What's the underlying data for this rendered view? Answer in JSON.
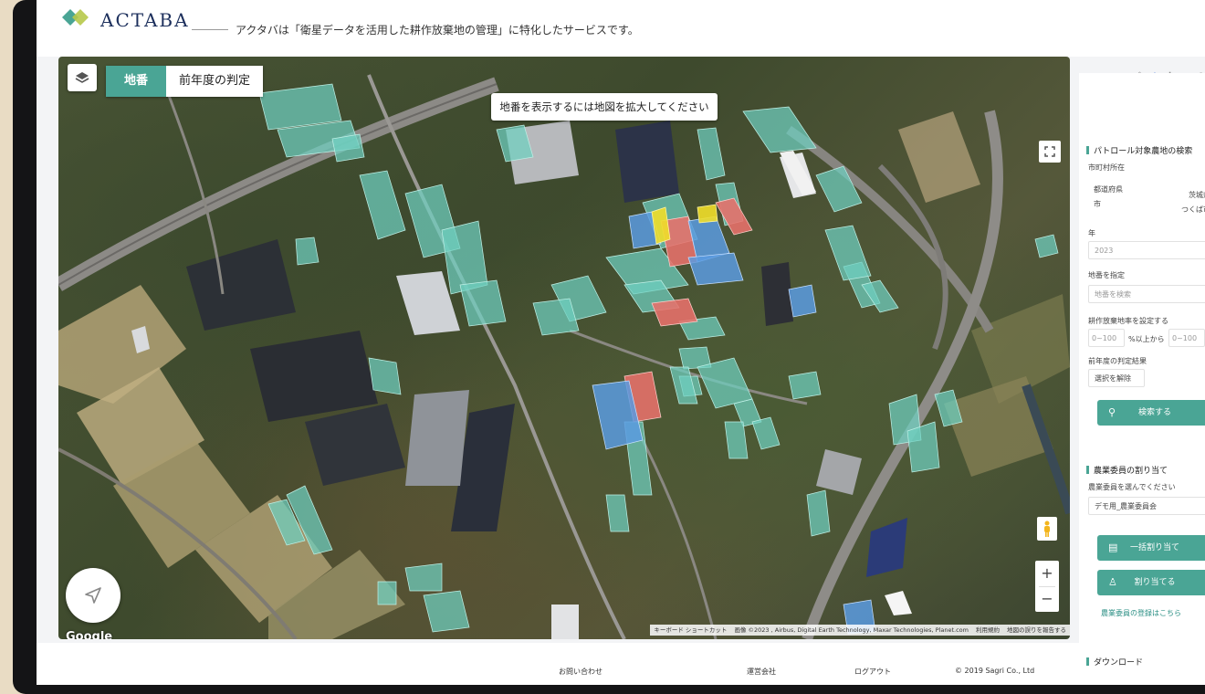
{
  "header": {
    "brand": "ACTABA",
    "tagline": "アクタバは「衛星データを活用した耕作放棄地の管理」に特化したサービスです。"
  },
  "map": {
    "tab_parcel": "地番",
    "tab_prev_year": "前年度の判定",
    "zoom_message": "地番を表示するには地図を拡大してください",
    "zoom_in": "+",
    "zoom_out": "−",
    "google": "Google",
    "attribution": {
      "shortcuts": "キーボード ショートカット",
      "imagery": "画像 ©2023 , Airbus, Digital Earth Technology, Maxar Technologies, Planet.com",
      "terms": "利用規約",
      "report": "地図の誤りを報告する"
    }
  },
  "sidebar": {
    "search_title": "パトロール対象農地の検索",
    "municipality_label": "市町村所在",
    "prefecture_label": "都道府県",
    "prefecture_value": "茨城県",
    "city_label": "市",
    "city_value": "つくば市",
    "year_label": "年",
    "year_value": "2023",
    "parcel_label": "地番を指定",
    "parcel_placeholder": "地番を検索",
    "rate_label": "耕作放棄地率を設定する",
    "rate_min_placeholder": "0~100",
    "rate_mid": "%以上から",
    "rate_max_placeholder": "0~100",
    "prev_label": "前年度の判定結果",
    "clear_selection": "選択を解除",
    "search_button": "検索する",
    "assign_title": "農業委員の割り当て",
    "committee_label": "農業委員を選んでください",
    "committee_value": "デモ用_農業委員会",
    "bulk_assign_button": "一括割り当て",
    "assign_button": "割り当てる",
    "register_link": "農業委員の登録はこちら",
    "download_title": "ダウンロード"
  },
  "footer": {
    "contact": "お問い合わせ",
    "company": "運営会社",
    "logout": "ログアウト",
    "copyright": "© 2019 Sagri Co., Ltd"
  },
  "colors": {
    "accent": "#4aa595",
    "parcel_teal": "#6fd0c0",
    "parcel_red": "#e8716b",
    "parcel_blue": "#5a9be0",
    "parcel_yellow": "#f0de2a",
    "brand_navy": "#1c2f5c"
  }
}
